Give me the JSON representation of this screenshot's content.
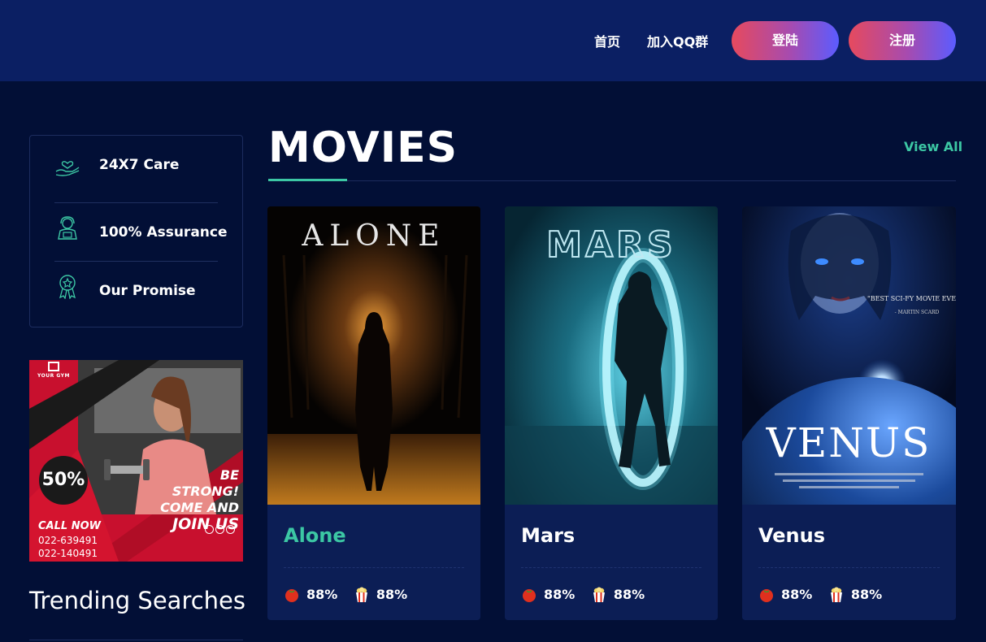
{
  "nav": {
    "home": "首页",
    "qq_group": "加入QQ群",
    "login": "登陆",
    "register": "注册"
  },
  "features": [
    {
      "label": "24X7 Care",
      "icon": "heart-hand-icon"
    },
    {
      "label": "100% Assurance",
      "icon": "support-agent-icon"
    },
    {
      "label": "Our Promise",
      "icon": "award-badge-icon"
    }
  ],
  "ad": {
    "brand": "YOUR GYM",
    "discount": "50%",
    "slogan_1": "BE STRONG!",
    "slogan_2": "COME AND",
    "slogan_3": "JOIN US",
    "call": "CALL NOW",
    "phone_1": "022-639491",
    "phone_2": "022-140491"
  },
  "trending_title": "Trending Searches",
  "section": {
    "title": "MOVIES",
    "view_all": "View All"
  },
  "movies": [
    {
      "title": "Alone",
      "poster_text": "ALONE",
      "tomato": "88%",
      "popcorn": "88%"
    },
    {
      "title": "Mars",
      "poster_text": "MARS",
      "tomato": "88%",
      "popcorn": "88%"
    },
    {
      "title": "Venus",
      "poster_text": "VENUS",
      "poster_quote": "\"BEST SCI-FY MOVIE EVER!\"",
      "poster_quote_by": "- MARTIN SCARD",
      "tomato": "88%",
      "popcorn": "88%"
    }
  ],
  "colors": {
    "background": "#020f36",
    "header": "#0b1f63",
    "card": "#0c1e55",
    "accent": "#3cc7a4",
    "gradient_start": "#e64a5e",
    "gradient_end": "#5b5cff"
  }
}
